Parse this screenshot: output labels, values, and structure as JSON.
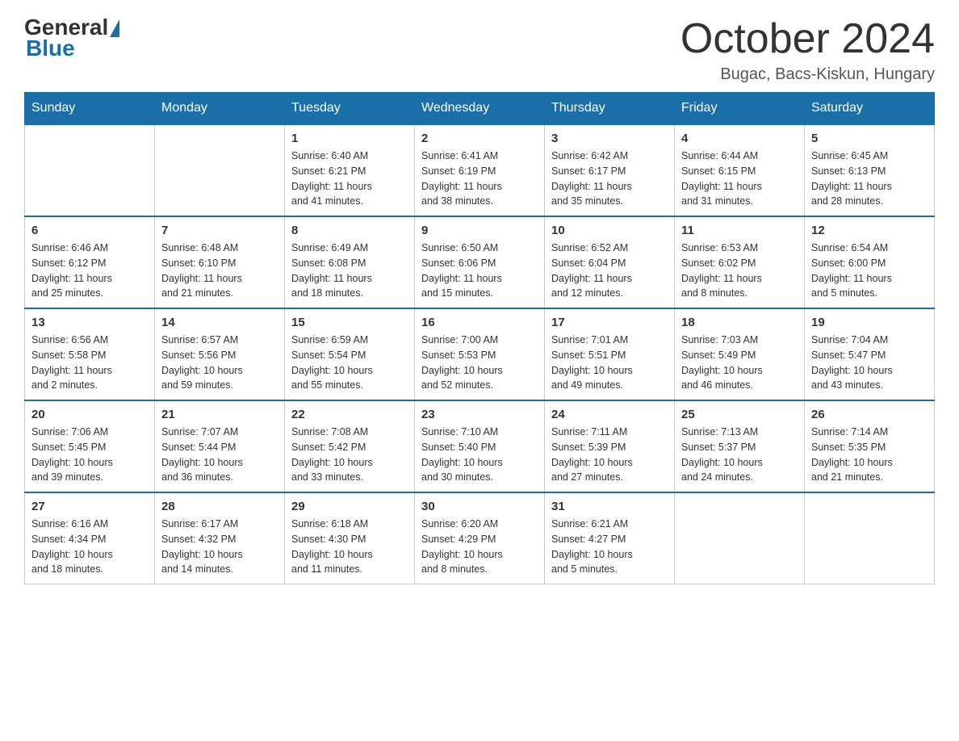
{
  "logo": {
    "general": "General",
    "blue": "Blue"
  },
  "header": {
    "title": "October 2024",
    "location": "Bugac, Bacs-Kiskun, Hungary"
  },
  "days_of_week": [
    "Sunday",
    "Monday",
    "Tuesday",
    "Wednesday",
    "Thursday",
    "Friday",
    "Saturday"
  ],
  "weeks": [
    [
      {
        "day": "",
        "info": ""
      },
      {
        "day": "",
        "info": ""
      },
      {
        "day": "1",
        "info": "Sunrise: 6:40 AM\nSunset: 6:21 PM\nDaylight: 11 hours\nand 41 minutes."
      },
      {
        "day": "2",
        "info": "Sunrise: 6:41 AM\nSunset: 6:19 PM\nDaylight: 11 hours\nand 38 minutes."
      },
      {
        "day": "3",
        "info": "Sunrise: 6:42 AM\nSunset: 6:17 PM\nDaylight: 11 hours\nand 35 minutes."
      },
      {
        "day": "4",
        "info": "Sunrise: 6:44 AM\nSunset: 6:15 PM\nDaylight: 11 hours\nand 31 minutes."
      },
      {
        "day": "5",
        "info": "Sunrise: 6:45 AM\nSunset: 6:13 PM\nDaylight: 11 hours\nand 28 minutes."
      }
    ],
    [
      {
        "day": "6",
        "info": "Sunrise: 6:46 AM\nSunset: 6:12 PM\nDaylight: 11 hours\nand 25 minutes."
      },
      {
        "day": "7",
        "info": "Sunrise: 6:48 AM\nSunset: 6:10 PM\nDaylight: 11 hours\nand 21 minutes."
      },
      {
        "day": "8",
        "info": "Sunrise: 6:49 AM\nSunset: 6:08 PM\nDaylight: 11 hours\nand 18 minutes."
      },
      {
        "day": "9",
        "info": "Sunrise: 6:50 AM\nSunset: 6:06 PM\nDaylight: 11 hours\nand 15 minutes."
      },
      {
        "day": "10",
        "info": "Sunrise: 6:52 AM\nSunset: 6:04 PM\nDaylight: 11 hours\nand 12 minutes."
      },
      {
        "day": "11",
        "info": "Sunrise: 6:53 AM\nSunset: 6:02 PM\nDaylight: 11 hours\nand 8 minutes."
      },
      {
        "day": "12",
        "info": "Sunrise: 6:54 AM\nSunset: 6:00 PM\nDaylight: 11 hours\nand 5 minutes."
      }
    ],
    [
      {
        "day": "13",
        "info": "Sunrise: 6:56 AM\nSunset: 5:58 PM\nDaylight: 11 hours\nand 2 minutes."
      },
      {
        "day": "14",
        "info": "Sunrise: 6:57 AM\nSunset: 5:56 PM\nDaylight: 10 hours\nand 59 minutes."
      },
      {
        "day": "15",
        "info": "Sunrise: 6:59 AM\nSunset: 5:54 PM\nDaylight: 10 hours\nand 55 minutes."
      },
      {
        "day": "16",
        "info": "Sunrise: 7:00 AM\nSunset: 5:53 PM\nDaylight: 10 hours\nand 52 minutes."
      },
      {
        "day": "17",
        "info": "Sunrise: 7:01 AM\nSunset: 5:51 PM\nDaylight: 10 hours\nand 49 minutes."
      },
      {
        "day": "18",
        "info": "Sunrise: 7:03 AM\nSunset: 5:49 PM\nDaylight: 10 hours\nand 46 minutes."
      },
      {
        "day": "19",
        "info": "Sunrise: 7:04 AM\nSunset: 5:47 PM\nDaylight: 10 hours\nand 43 minutes."
      }
    ],
    [
      {
        "day": "20",
        "info": "Sunrise: 7:06 AM\nSunset: 5:45 PM\nDaylight: 10 hours\nand 39 minutes."
      },
      {
        "day": "21",
        "info": "Sunrise: 7:07 AM\nSunset: 5:44 PM\nDaylight: 10 hours\nand 36 minutes."
      },
      {
        "day": "22",
        "info": "Sunrise: 7:08 AM\nSunset: 5:42 PM\nDaylight: 10 hours\nand 33 minutes."
      },
      {
        "day": "23",
        "info": "Sunrise: 7:10 AM\nSunset: 5:40 PM\nDaylight: 10 hours\nand 30 minutes."
      },
      {
        "day": "24",
        "info": "Sunrise: 7:11 AM\nSunset: 5:39 PM\nDaylight: 10 hours\nand 27 minutes."
      },
      {
        "day": "25",
        "info": "Sunrise: 7:13 AM\nSunset: 5:37 PM\nDaylight: 10 hours\nand 24 minutes."
      },
      {
        "day": "26",
        "info": "Sunrise: 7:14 AM\nSunset: 5:35 PM\nDaylight: 10 hours\nand 21 minutes."
      }
    ],
    [
      {
        "day": "27",
        "info": "Sunrise: 6:16 AM\nSunset: 4:34 PM\nDaylight: 10 hours\nand 18 minutes."
      },
      {
        "day": "28",
        "info": "Sunrise: 6:17 AM\nSunset: 4:32 PM\nDaylight: 10 hours\nand 14 minutes."
      },
      {
        "day": "29",
        "info": "Sunrise: 6:18 AM\nSunset: 4:30 PM\nDaylight: 10 hours\nand 11 minutes."
      },
      {
        "day": "30",
        "info": "Sunrise: 6:20 AM\nSunset: 4:29 PM\nDaylight: 10 hours\nand 8 minutes."
      },
      {
        "day": "31",
        "info": "Sunrise: 6:21 AM\nSunset: 4:27 PM\nDaylight: 10 hours\nand 5 minutes."
      },
      {
        "day": "",
        "info": ""
      },
      {
        "day": "",
        "info": ""
      }
    ]
  ]
}
